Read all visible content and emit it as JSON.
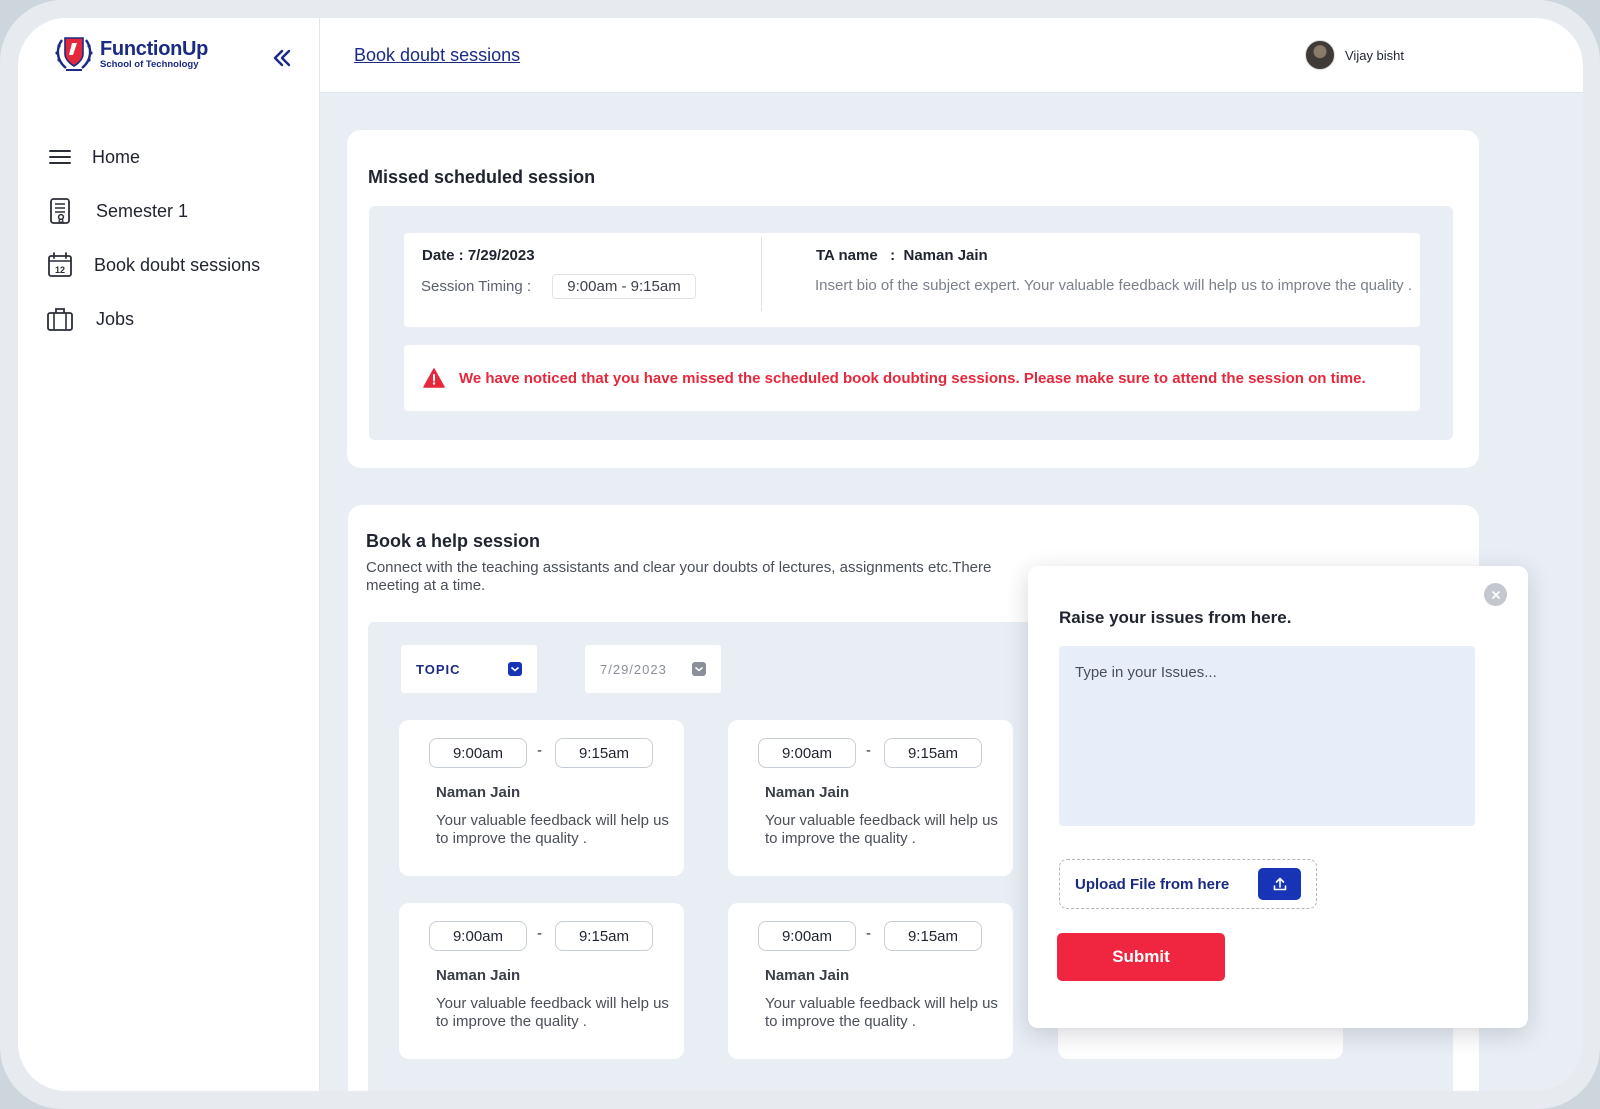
{
  "brand": {
    "name": "FunctionUp",
    "subtitle": "School of Technology",
    "color": "#1b2a83"
  },
  "sidebar": {
    "items": [
      {
        "label": "Home",
        "icon": "menu-icon"
      },
      {
        "label": "Semester 1",
        "icon": "document-icon"
      },
      {
        "label": "Book doubt sessions",
        "icon": "calendar-icon",
        "icon_text": "12"
      },
      {
        "label": "Jobs",
        "icon": "briefcase-icon"
      }
    ]
  },
  "header": {
    "breadcrumb": "Book doubt sessions",
    "user_name": "Vijay bisht"
  },
  "missed": {
    "title": "Missed scheduled session",
    "date": "Date : 7/29/2023",
    "timing_label": "Session Timing :",
    "timing_value": "9:00am - 9:15am",
    "ta_name": "TA name   :  Naman Jain",
    "ta_bio": "Insert bio of the subject expert. Your valuable feedback will help us to improve the quality .",
    "alert": "We have noticed that you have missed the scheduled  book doubting sessions. Please make sure to attend the session on time.",
    "alert_color": "#e5283c"
  },
  "help": {
    "title": "Book a help session",
    "description": "Connect with the teaching assistants and clear your doubts of lectures, assignments etc.There",
    "description_line2": "meeting at a time.",
    "filters": {
      "topic": "TOPIC",
      "date": "7/29/2023"
    },
    "slots": [
      {
        "start": "9:00am",
        "end": "9:15am",
        "name": "Naman Jain",
        "desc": "Your valuable feedback will help us to improve the quality ."
      },
      {
        "start": "9:00am",
        "end": "9:15am",
        "name": "Naman Jain",
        "desc": "Your valuable feedback will help us to improve the quality ."
      },
      {
        "start": "9:00am",
        "end": "9:15am",
        "name": "Naman Jain",
        "desc": "Your valuable feedback will help us to improve the quality ."
      },
      {
        "start": "9:00am",
        "end": "9:15am",
        "name": "Naman Jain",
        "desc": "Your valuable feedback will help us to improve the quality ."
      }
    ],
    "dash": "-"
  },
  "modal": {
    "title": "Raise your issues from here.",
    "placeholder": "Type in your Issues...",
    "upload_label": "Upload File from here",
    "submit_label": "Submit",
    "accent": "#1634b5",
    "submit_color": "#f0253f"
  }
}
